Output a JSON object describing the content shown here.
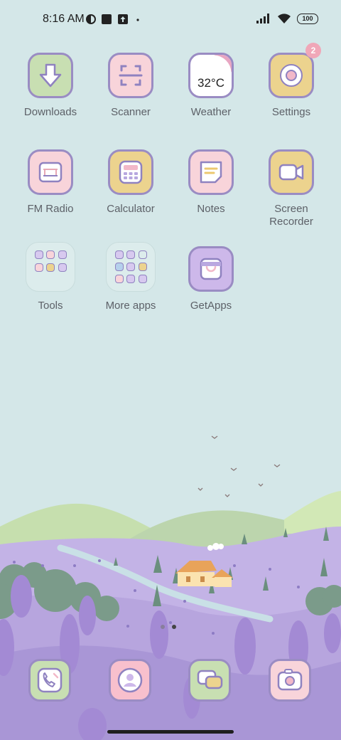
{
  "status_bar": {
    "time": "8:16 AM",
    "battery": "100"
  },
  "apps": [
    {
      "label": "Downloads"
    },
    {
      "label": "Scanner"
    },
    {
      "label": "Weather",
      "temp": "32°C"
    },
    {
      "label": "Settings",
      "badge": "2"
    },
    {
      "label": "FM Radio"
    },
    {
      "label": "Calculator"
    },
    {
      "label": "Notes"
    },
    {
      "label": "Screen\nRecorder"
    },
    {
      "label": "Tools"
    },
    {
      "label": "More apps"
    },
    {
      "label": "GetApps"
    }
  ],
  "pages": {
    "current": 2,
    "total": 2
  },
  "colors": {
    "background": "#d4e7e8",
    "icon_border": "#9a8cc3",
    "green": "#c8dfb2",
    "pink": "#f8d4da",
    "yellow": "#ecd38e",
    "lavender": "#cdb8ea",
    "badge": "#f0a7b8"
  }
}
